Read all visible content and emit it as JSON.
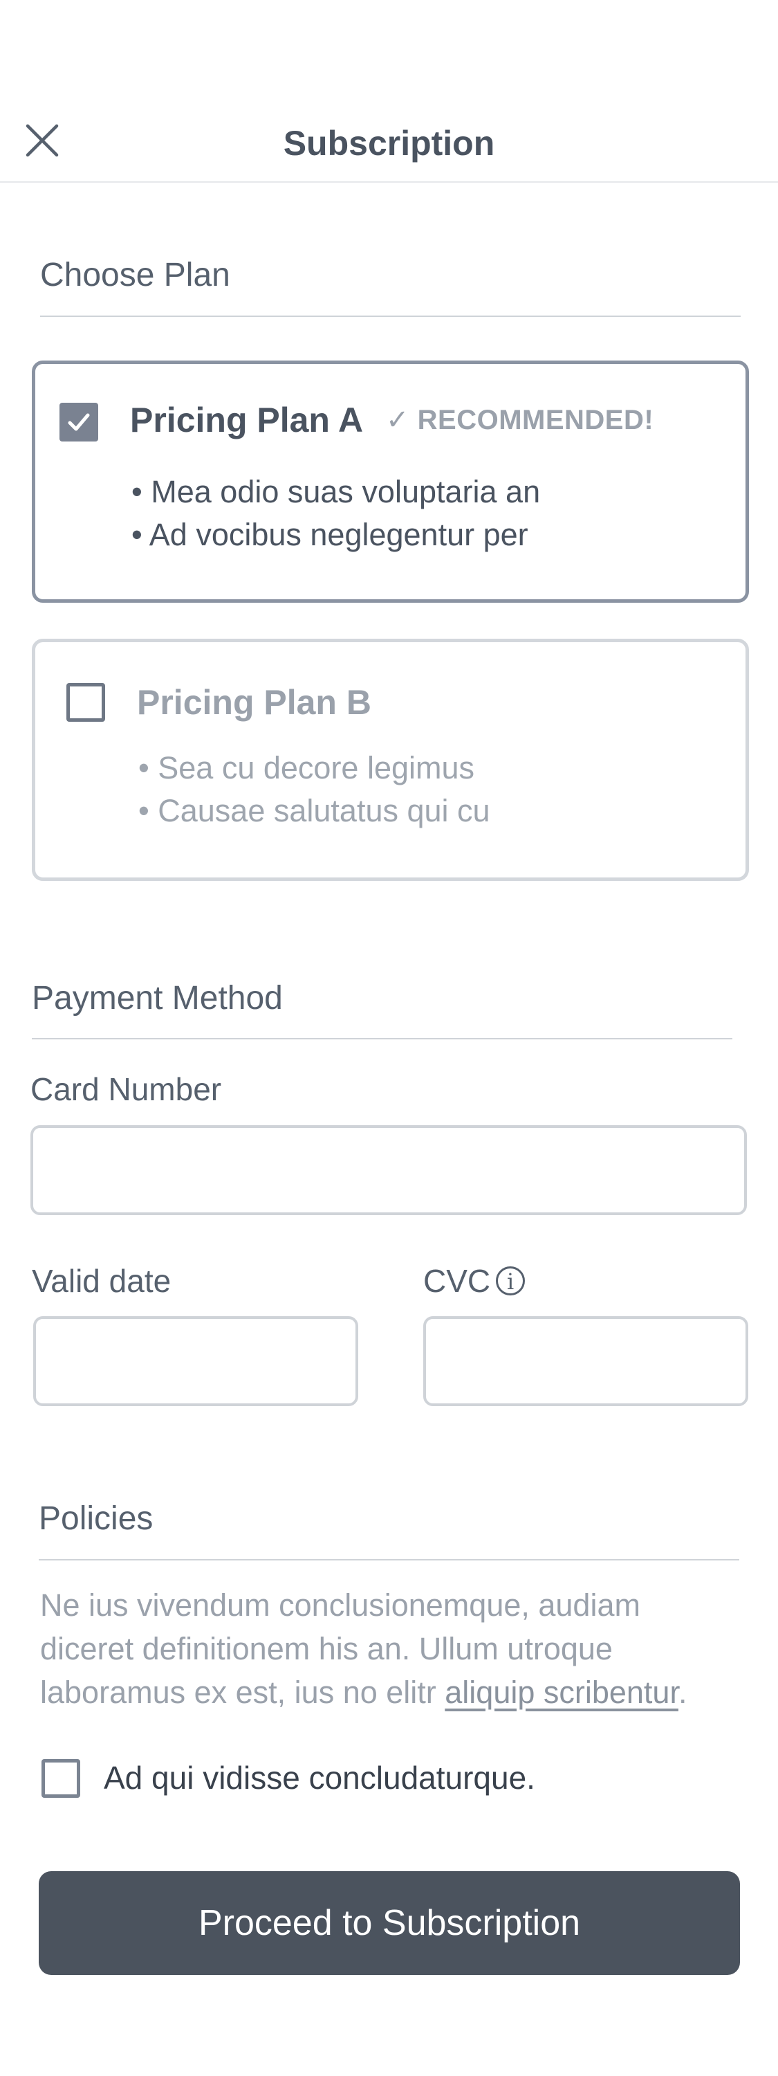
{
  "header": {
    "title": "Subscription",
    "close_icon": "close-icon"
  },
  "choose_plan": {
    "title": "Choose Plan",
    "plans": [
      {
        "name": "Pricing Plan A",
        "selected": true,
        "badge": "✓ RECOMMENDED!",
        "features": [
          "• Mea odio suas voluptaria an",
          "• Ad vocibus neglegentur per"
        ]
      },
      {
        "name": "Pricing Plan B",
        "selected": false,
        "features": [
          "• Sea cu decore legimus",
          "• Causae salutatus qui cu"
        ]
      }
    ]
  },
  "payment": {
    "title": "Payment Method",
    "card_number_label": "Card Number",
    "card_number_value": "",
    "valid_date_label": "Valid date",
    "valid_date_value": "",
    "cvc_label": "CVC",
    "cvc_value": "",
    "info_glyph": "i"
  },
  "policies": {
    "title": "Policies",
    "text": "Ne ius vivendum conclusionemque, audiam diceret definitionem his an. Ullum utroque laboramus ex est, ius no elitr ",
    "link": "aliquip scribentur",
    "text_end": ".",
    "agree_label": "Ad qui vidisse concludaturque.",
    "agree_checked": false
  },
  "proceed_label": "Proceed to Subscription",
  "colors": {
    "primary": "#4b535e",
    "border_selected": "#8a93a2",
    "border": "#d3d7dc",
    "muted_text": "#9aa1ab"
  }
}
